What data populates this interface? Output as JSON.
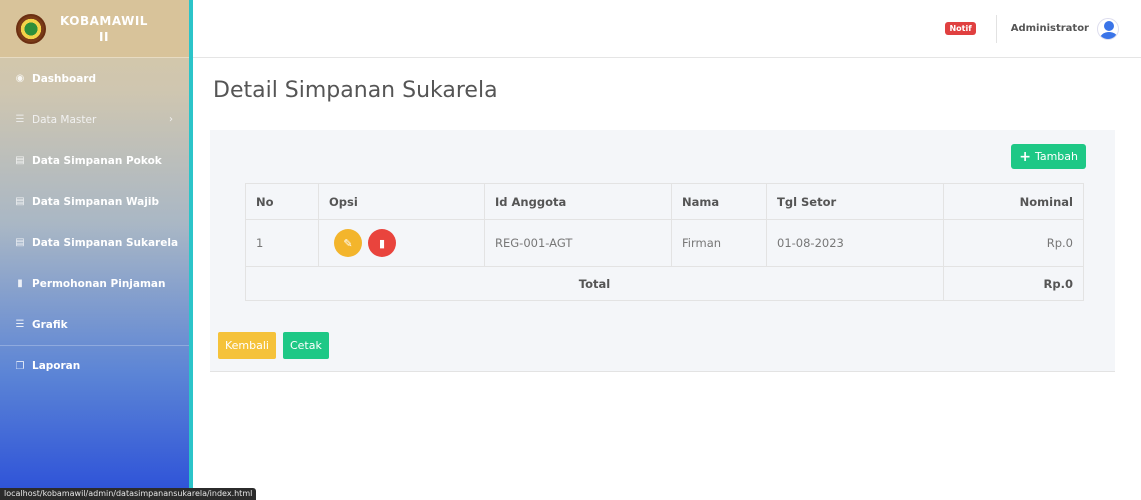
{
  "brand": {
    "line1": "KOBAMAWIL",
    "line2": "II"
  },
  "sidebar": {
    "items": [
      {
        "label": "Dashboard",
        "icon": "dashboard-icon"
      },
      {
        "label": "Data Master",
        "icon": "list-icon"
      },
      {
        "label": "Data Simpanan Pokok",
        "icon": "table-icon"
      },
      {
        "label": "Data Simpanan Wajib",
        "icon": "table-icon"
      },
      {
        "label": "Data Simpanan Sukarela",
        "icon": "table-icon"
      },
      {
        "label": "Permohonan Pinjaman",
        "icon": "file-icon"
      },
      {
        "label": "Grafik",
        "icon": "list-icon"
      },
      {
        "label": "Laporan",
        "icon": "copy-icon"
      }
    ]
  },
  "topbar": {
    "notif": "Notif",
    "user": "Administrator"
  },
  "page": {
    "title": "Detail Simpanan Sukarela"
  },
  "toolbar": {
    "add_label": "Tambah"
  },
  "table": {
    "headers": [
      "No",
      "Opsi",
      "Id Anggota",
      "Nama",
      "Tgl Setor",
      "Nominal"
    ],
    "rows": [
      {
        "no": "1",
        "id": "REG-001-AGT",
        "nama": "Firman",
        "tgl": "01-08-2023",
        "nominal": "Rp.0"
      }
    ],
    "total_label": "Total",
    "total_value": "Rp.0"
  },
  "actions": {
    "back": "Kembali",
    "print": "Cetak"
  },
  "status_url": "localhost/kobamawil/admin/datasimpanansukarela/index.html",
  "colors": {
    "accent_green": "#1ec886",
    "warning": "#f5c23a",
    "danger": "#e9443d",
    "sidebar_border": "#2bc4c9"
  }
}
